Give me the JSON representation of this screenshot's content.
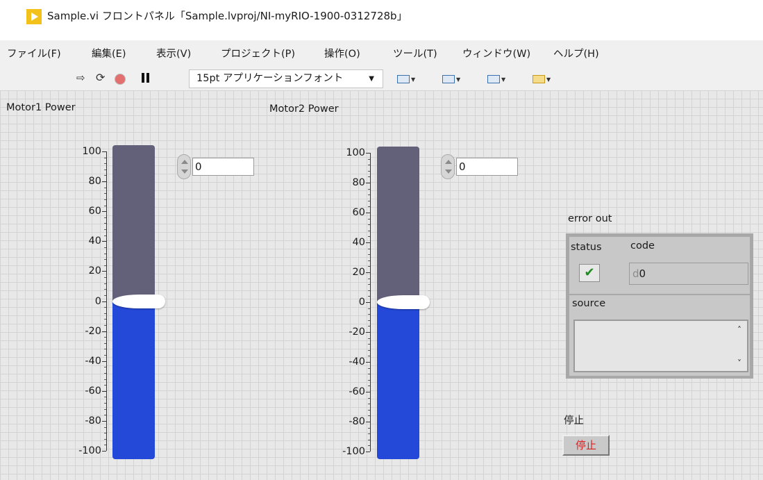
{
  "window": {
    "title": "Sample.vi フロントパネル「Sample.lvproj/NI-myRIO-1900-0312728b」"
  },
  "menu": [
    "ファイル(F)",
    "編集(E)",
    "表示(V)",
    "プロジェクト(P)",
    "操作(O)",
    "ツール(T)",
    "ウィンドウ(W)",
    "ヘルプ(H)"
  ],
  "toolbar": {
    "font_selector": "15pt アプリケーションフォント",
    "run_icon": "⇨",
    "run_continuous_icon": "⟳"
  },
  "motor1": {
    "label": "Motor1 Power",
    "value": 0,
    "numeric_value": "0"
  },
  "motor2": {
    "label": "Motor2 Power",
    "value": 0,
    "numeric_value": "0"
  },
  "slider_scale": {
    "min": -100,
    "max": 100,
    "ticks": [
      "100",
      "80",
      "60",
      "40",
      "20",
      "0",
      "-20",
      "-40",
      "-60",
      "-80",
      "-100"
    ]
  },
  "error_out": {
    "label": "error out",
    "status_label": "status",
    "status_glyph": "✔",
    "code_label": "code",
    "code_radix": "d",
    "code_value": "0",
    "source_label": "source",
    "source_value": "",
    "scroll_up": "˄",
    "scroll_down": "˅"
  },
  "stop": {
    "label": "停止",
    "button_text": "停止"
  },
  "colors": {
    "slider_fill": "#2449d8",
    "slider_track": "#63607a",
    "stop_text": "#d82020"
  }
}
